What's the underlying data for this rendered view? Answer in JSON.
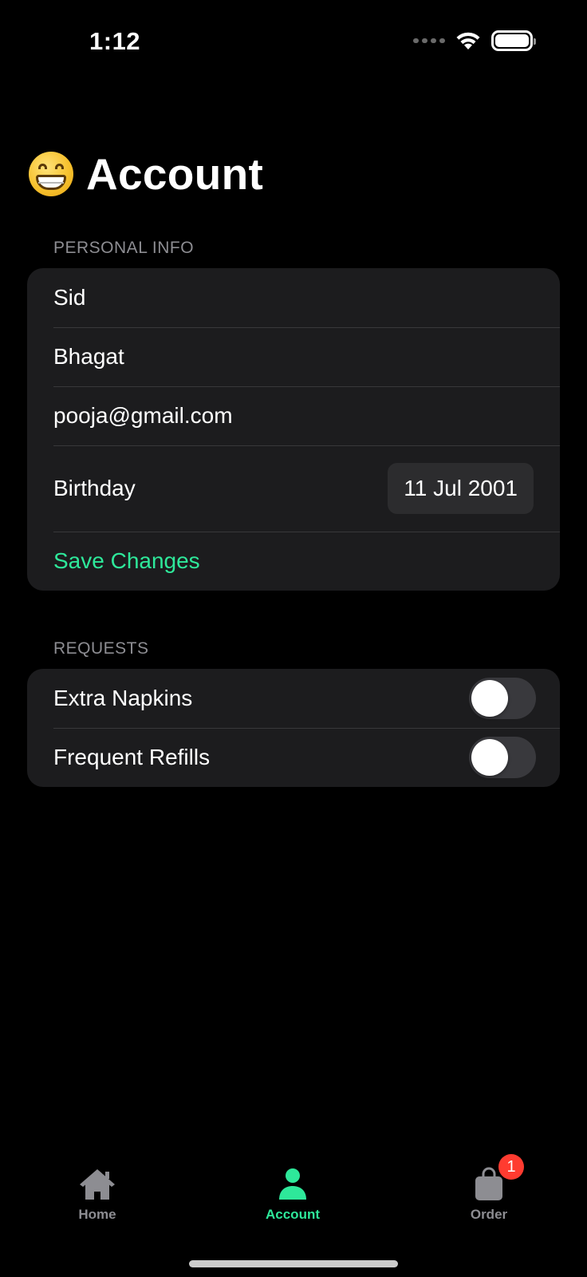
{
  "status_bar": {
    "time": "1:12"
  },
  "header": {
    "title": "Account",
    "emoji_icon": "grinning-face-with-smiling-eyes"
  },
  "personal_info": {
    "section_label": "PERSONAL INFO",
    "first_name": "Sid",
    "last_name": "Bhagat",
    "email": "pooja@gmail.com",
    "birthday_label": "Birthday",
    "birthday_value": "11 Jul 2001",
    "save_label": "Save Changes"
  },
  "requests": {
    "section_label": "REQUESTS",
    "items": [
      {
        "label": "Extra Napkins",
        "enabled": false
      },
      {
        "label": "Frequent Refills",
        "enabled": false
      }
    ]
  },
  "tab_bar": {
    "items": [
      {
        "label": "Home",
        "icon": "house-icon",
        "selected": false
      },
      {
        "label": "Account",
        "icon": "person-icon",
        "selected": true
      },
      {
        "label": "Order",
        "icon": "bag-icon",
        "selected": false,
        "badge": "1"
      }
    ]
  },
  "colors": {
    "accent": "#2ee89a",
    "card": "#1c1c1e",
    "badge": "#ff3b30",
    "inactive": "#8d8d92"
  }
}
